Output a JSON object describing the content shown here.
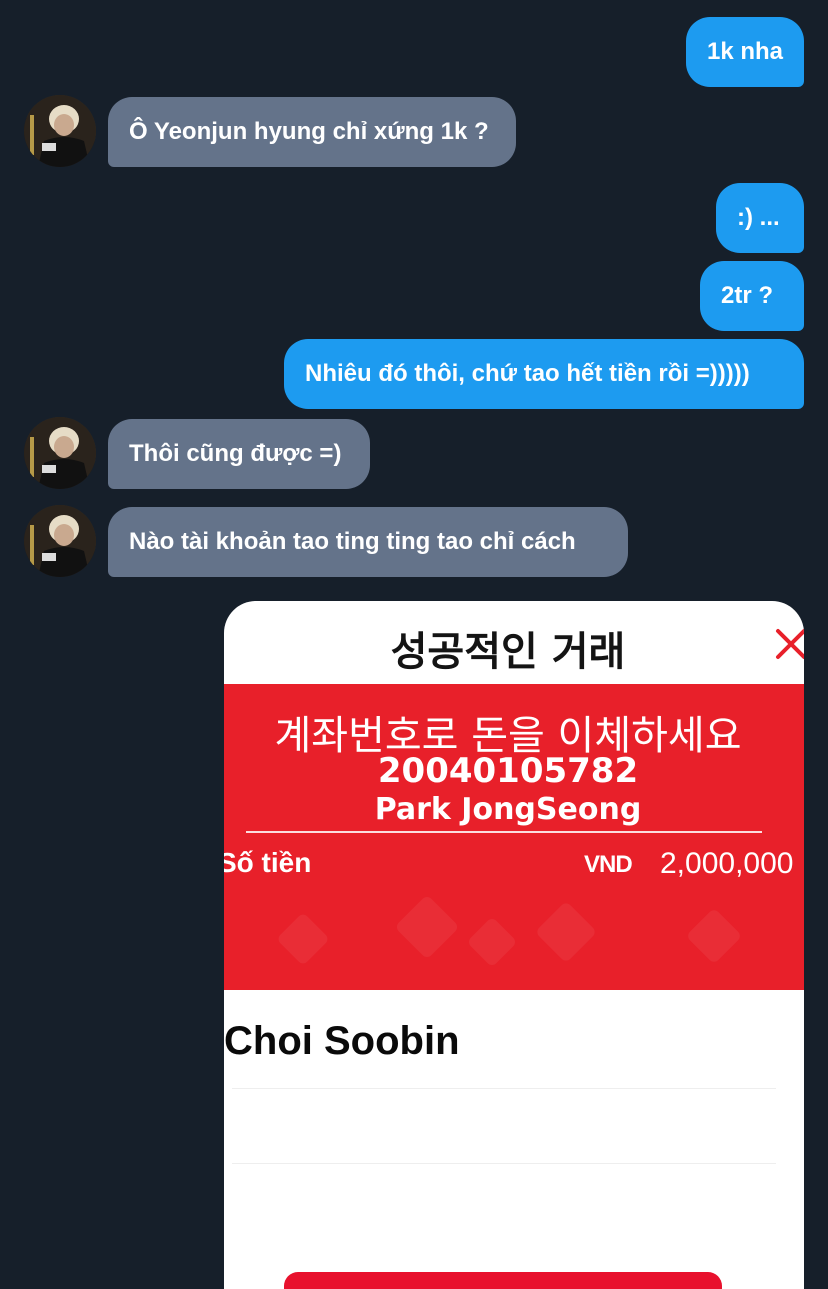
{
  "messages": [
    {
      "id": "m1",
      "direction": "out",
      "text": "1k nha"
    },
    {
      "id": "m2",
      "direction": "in",
      "text": "Ô Yeonjun hyung chỉ xứng 1k ?"
    },
    {
      "id": "m3",
      "direction": "out",
      "text": ":) ..."
    },
    {
      "id": "m4",
      "direction": "out",
      "text": "2tr ?"
    },
    {
      "id": "m5",
      "direction": "out",
      "text": "Nhiêu đó thôi, chứ tao hết tiền rồi =)))))"
    },
    {
      "id": "m6",
      "direction": "in",
      "text": "Thôi cũng được =)"
    },
    {
      "id": "m7",
      "direction": "in",
      "text": "Nào tài khoản tao ting ting tao chỉ cách"
    }
  ],
  "receipt": {
    "title": "성공적인 거래",
    "instruction": "계좌번호로 돈을 이체하세요",
    "account_number": "20040105782",
    "account_name": "Park JongSeong",
    "amount_label": "Số tiền",
    "currency": "VND",
    "amount": "2,000,000",
    "payer": "Choi Soobin"
  },
  "colors": {
    "background": "#161f2a",
    "outgoing_bubble": "#1d9bf0",
    "incoming_bubble": "#64738a",
    "receipt_red": "#e8202a"
  },
  "icons": {
    "close": "close-icon",
    "avatar": "user-avatar"
  }
}
